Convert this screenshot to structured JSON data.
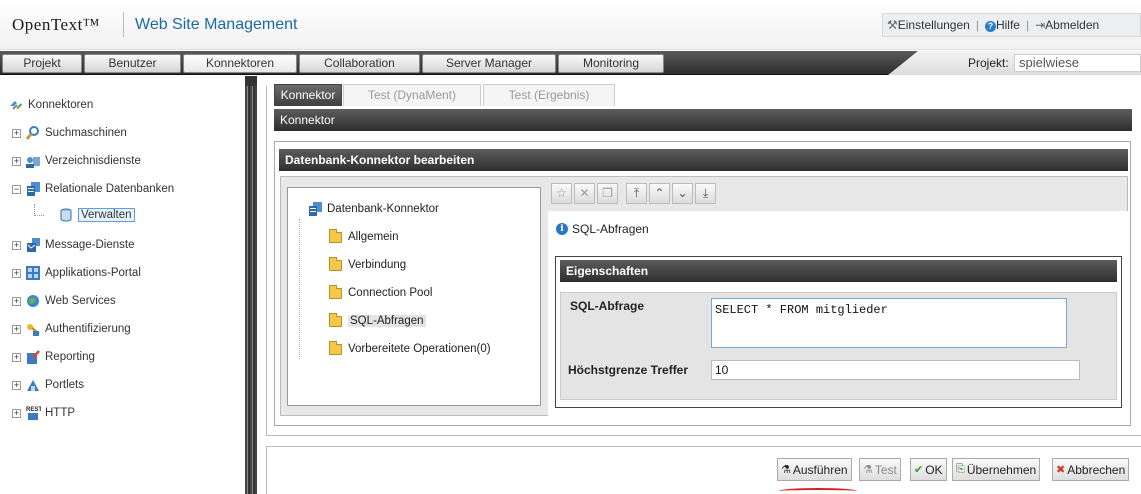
{
  "header": {
    "brand": "OpenText™",
    "app_title": "Web Site Management",
    "links": {
      "settings": "Einstellungen",
      "help": "Hilfe",
      "logout": "Abmelden"
    }
  },
  "nav": {
    "tabs": [
      "Projekt",
      "Benutzer",
      "Konnektoren",
      "Collaboration",
      "Server Manager",
      "Monitoring"
    ],
    "active_tab": "Konnektoren",
    "project_label": "Projekt:",
    "project_value": "spielwiese"
  },
  "sidebar": {
    "root": "Konnektoren",
    "items": [
      {
        "label": "Suchmaschinen",
        "expander": "+"
      },
      {
        "label": "Verzeichnisdienste",
        "expander": "+"
      },
      {
        "label": "Relationale Datenbanken",
        "expander": "−"
      },
      {
        "label": "Verwalten",
        "expander": ""
      },
      {
        "label": "Message-Dienste",
        "expander": "+"
      },
      {
        "label": "Applikations-Portal",
        "expander": "+"
      },
      {
        "label": "Web Services",
        "expander": "+"
      },
      {
        "label": "Authentifizierung",
        "expander": "+"
      },
      {
        "label": "Reporting",
        "expander": "+"
      },
      {
        "label": "Portlets",
        "expander": "+"
      },
      {
        "label": "HTTP",
        "expander": "+"
      }
    ]
  },
  "content": {
    "tabs": [
      "Konnektor",
      "Test (DynaMent)",
      "Test (Ergebnis)"
    ],
    "section_header": "Konnektor",
    "panel_header": "Datenbank-Konnektor bearbeiten",
    "tree": {
      "root": "Datenbank-Konnektor",
      "items": [
        "Allgemein",
        "Verbindung",
        "Connection Pool",
        "SQL-Abfragen",
        "Vorbereitete Operationen(0)"
      ],
      "selected": "SQL-Abfragen"
    },
    "detail_title": "SQL-Abfragen",
    "properties_header": "Eigenschaften",
    "sql_label": "SQL-Abfrage",
    "sql_value": "SELECT * FROM mitglieder",
    "limit_label": "Höchstgrenze Treffer",
    "limit_value": "10"
  },
  "buttons": {
    "execute": "Ausführen",
    "test": "Test",
    "ok": "OK",
    "apply": "Übernehmen",
    "cancel": "Abbrechen"
  }
}
